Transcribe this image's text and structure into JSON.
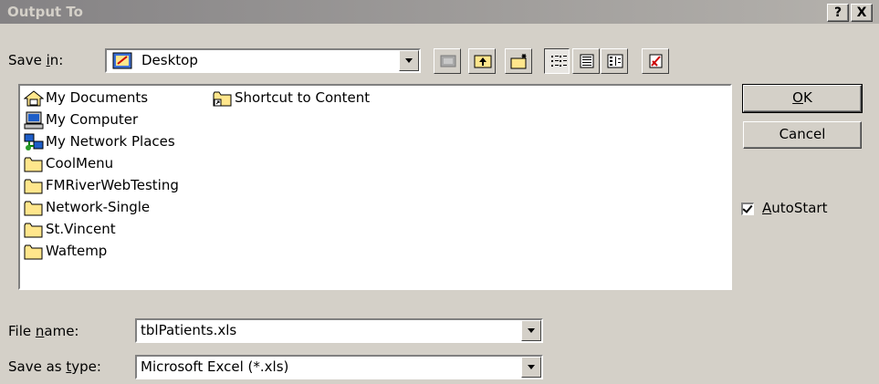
{
  "window": {
    "title": "Output To",
    "help_label": "?",
    "close_label": "X"
  },
  "save_in": {
    "label_pre": "Save ",
    "label_key": "i",
    "label_post": "n:",
    "value": "Desktop"
  },
  "toolbar": {
    "icons": [
      "back-icon",
      "up-folder-icon",
      "new-folder-icon",
      "list-view-icon",
      "details-view-icon",
      "properties-icon",
      "tools-icon"
    ]
  },
  "files": {
    "column1": [
      {
        "label": "My Documents",
        "icon": "my-documents-icon"
      },
      {
        "label": "My Computer",
        "icon": "my-computer-icon"
      },
      {
        "label": "My Network Places",
        "icon": "network-places-icon"
      },
      {
        "label": "CoolMenu",
        "icon": "folder-icon"
      },
      {
        "label": "FMRiverWebTesting",
        "icon": "folder-icon"
      },
      {
        "label": "Network-Single",
        "icon": "folder-icon"
      },
      {
        "label": "St.Vincent",
        "icon": "folder-icon"
      },
      {
        "label": "Waftemp",
        "icon": "folder-icon"
      }
    ],
    "column2": [
      {
        "label": "Shortcut to Content",
        "icon": "shortcut-folder-icon"
      }
    ]
  },
  "buttons": {
    "ok_key": "O",
    "ok_rest": "K",
    "cancel": "Cancel"
  },
  "autostart": {
    "key": "A",
    "rest": "utoStart",
    "checked": true
  },
  "file_name": {
    "label_pre": "File ",
    "label_key": "n",
    "label_post": "ame:",
    "value": "tblPatients.xls"
  },
  "save_type": {
    "label_pre": "Save as ",
    "label_key": "t",
    "label_post": "ype:",
    "value": "Microsoft Excel (*.xls)"
  },
  "colors": {
    "face": "#d4d0c8",
    "title_start": "#848284",
    "title_end": "#b5b2ad",
    "folder": "#ffe68c"
  }
}
